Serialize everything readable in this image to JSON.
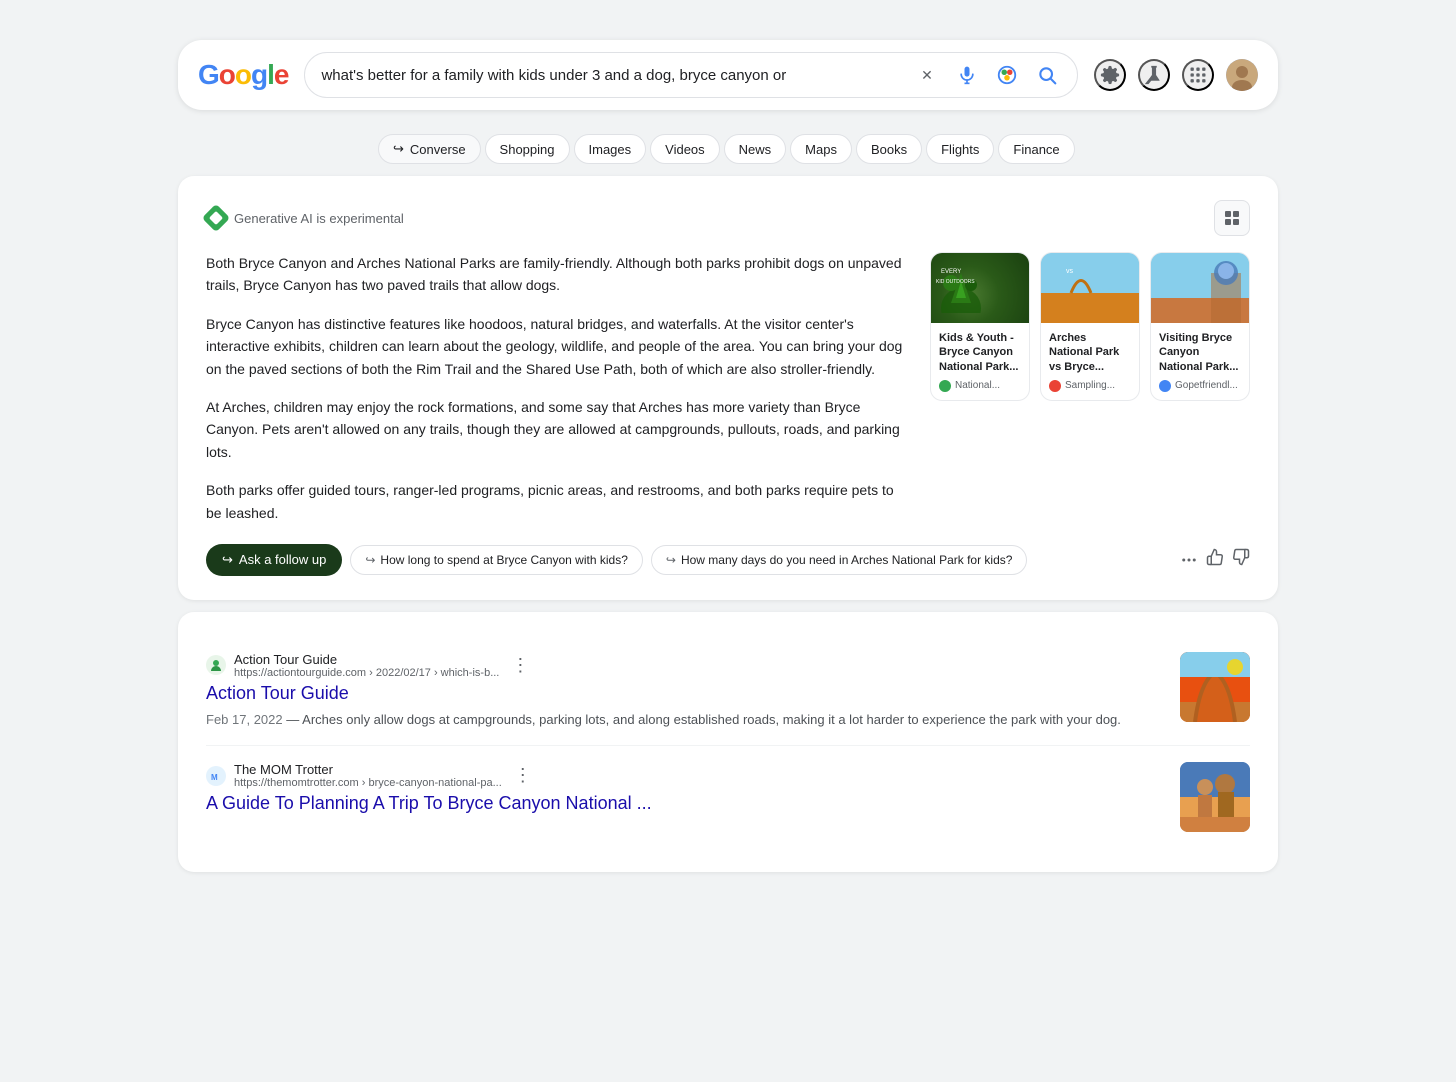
{
  "header": {
    "logo_letters": [
      "G",
      "o",
      "o",
      "g",
      "l",
      "e"
    ],
    "search_value": "what's better for a family with kids under 3 and a dog, bryce canyon or",
    "settings_label": "Settings",
    "labs_label": "Labs",
    "grid_label": "Google apps",
    "avatar_label": "Account"
  },
  "nav": {
    "tabs": [
      {
        "label": "Converse",
        "has_arrow": true
      },
      {
        "label": "Shopping",
        "has_arrow": false
      },
      {
        "label": "Images",
        "has_arrow": false
      },
      {
        "label": "Videos",
        "has_arrow": false
      },
      {
        "label": "News",
        "has_arrow": false
      },
      {
        "label": "Maps",
        "has_arrow": false
      },
      {
        "label": "Books",
        "has_arrow": false
      },
      {
        "label": "Flights",
        "has_arrow": false
      },
      {
        "label": "Finance",
        "has_arrow": false
      }
    ]
  },
  "ai_section": {
    "label": "Generative AI is experimental",
    "grid_view_label": "Grid view",
    "paragraphs": [
      "Both Bryce Canyon and Arches National Parks are family-friendly. Although both parks prohibit dogs on unpaved trails, Bryce Canyon has two paved trails that allow dogs.",
      "Bryce Canyon has distinctive features like hoodoos, natural bridges, and waterfalls. At the visitor center's interactive exhibits, children can learn about the geology, wildlife, and people of the area. You can bring your dog on the paved sections of both the Rim Trail and the Shared Use Path, both of which are also stroller-friendly.",
      "At Arches, children may enjoy the rock formations, and some say that Arches has more variety than Bryce Canyon. Pets aren't allowed on any trails, though they are allowed at campgrounds, pullouts, roads, and parking lots.",
      "Both parks offer guided tours, ranger-led programs, picnic areas, and restrooms, and both parks require pets to be leashed."
    ],
    "cards": [
      {
        "title": "Kids & Youth - Bryce Canyon National Park...",
        "source": "National...",
        "source_color": "green"
      },
      {
        "title": "Arches National Park vs Bryce...",
        "source": "Sampling...",
        "source_color": "orange"
      },
      {
        "title": "Visiting Bryce Canyon National Park...",
        "source": "Gopetfriendl...",
        "source_color": "blue"
      }
    ],
    "actions": {
      "follow_up_label": "Ask a follow up",
      "suggestion1": "How long to spend at Bryce Canyon with kids?",
      "suggestion2": "How many days do you need in Arches National Park for kids?",
      "more_label": "More",
      "thumbs_up_label": "Thumbs up",
      "thumbs_down_label": "Thumbs down"
    }
  },
  "results": [
    {
      "source_name": "Action Tour Guide",
      "url": "https://actiontourguide.com › 2022/02/17 › which-is-b...",
      "title": "Action Tour Guide",
      "date": "Feb 17, 2022",
      "snippet": "— Arches only allow dogs at campgrounds, parking lots, and along established roads, making it a lot harder to experience the park with your dog.",
      "has_thumb": true,
      "favicon_color": "green"
    },
    {
      "source_name": "The MOM Trotter",
      "url": "https://themomtrotter.com › bryce-canyon-national-pa...",
      "title": "A Guide To Planning A Trip To Bryce Canyon National ...",
      "date": "",
      "snippet": "",
      "has_thumb": true,
      "favicon_color": "blue"
    }
  ]
}
